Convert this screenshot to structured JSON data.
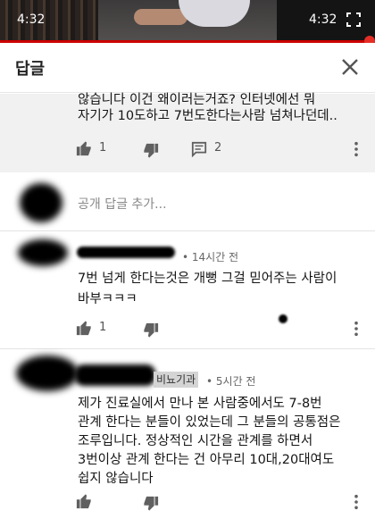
{
  "player": {
    "time_left": "4:32",
    "time_right": "4:32",
    "progress": 1.0
  },
  "header": {
    "title": "답글"
  },
  "comment_top": {
    "line1": "않습니다 이건 왜이러는거죠? 인터넷에선 뭐",
    "line2": "자기가 10도하고 7번도한다는사람 넘쳐나던데..",
    "likes": "1",
    "replies": "2"
  },
  "add_reply": {
    "placeholder": "공개 답글 추가..."
  },
  "comment_1": {
    "time": "• 14시간 전",
    "line1": "7번 넘게 한다는것은 개뻥  그걸 믿어주는 사람이",
    "line2": "바부ㅋㅋㅋ",
    "likes": "1"
  },
  "comment_2": {
    "author_tag": "비뇨기과",
    "time": "• 5시간 전",
    "lines": [
      "제가 진료실에서 만나 본 사람중에서도 7-8번",
      "관계 한다는 분들이 있었는데 그 분들의 공통점은",
      "조루입니다. 정상적인 시간을 관계를 하면서",
      "3번이상 관계 한다는 건 아무리 10대,20대여도",
      "쉽지 않습니다"
    ]
  },
  "colors": {
    "accent": "#cc0000",
    "text": "#151515",
    "muted": "#888888"
  },
  "icons": [
    "fullscreen-icon",
    "close-icon",
    "thumb-up-icon",
    "thumb-down-icon",
    "comment-icon",
    "more-vert-icon"
  ]
}
